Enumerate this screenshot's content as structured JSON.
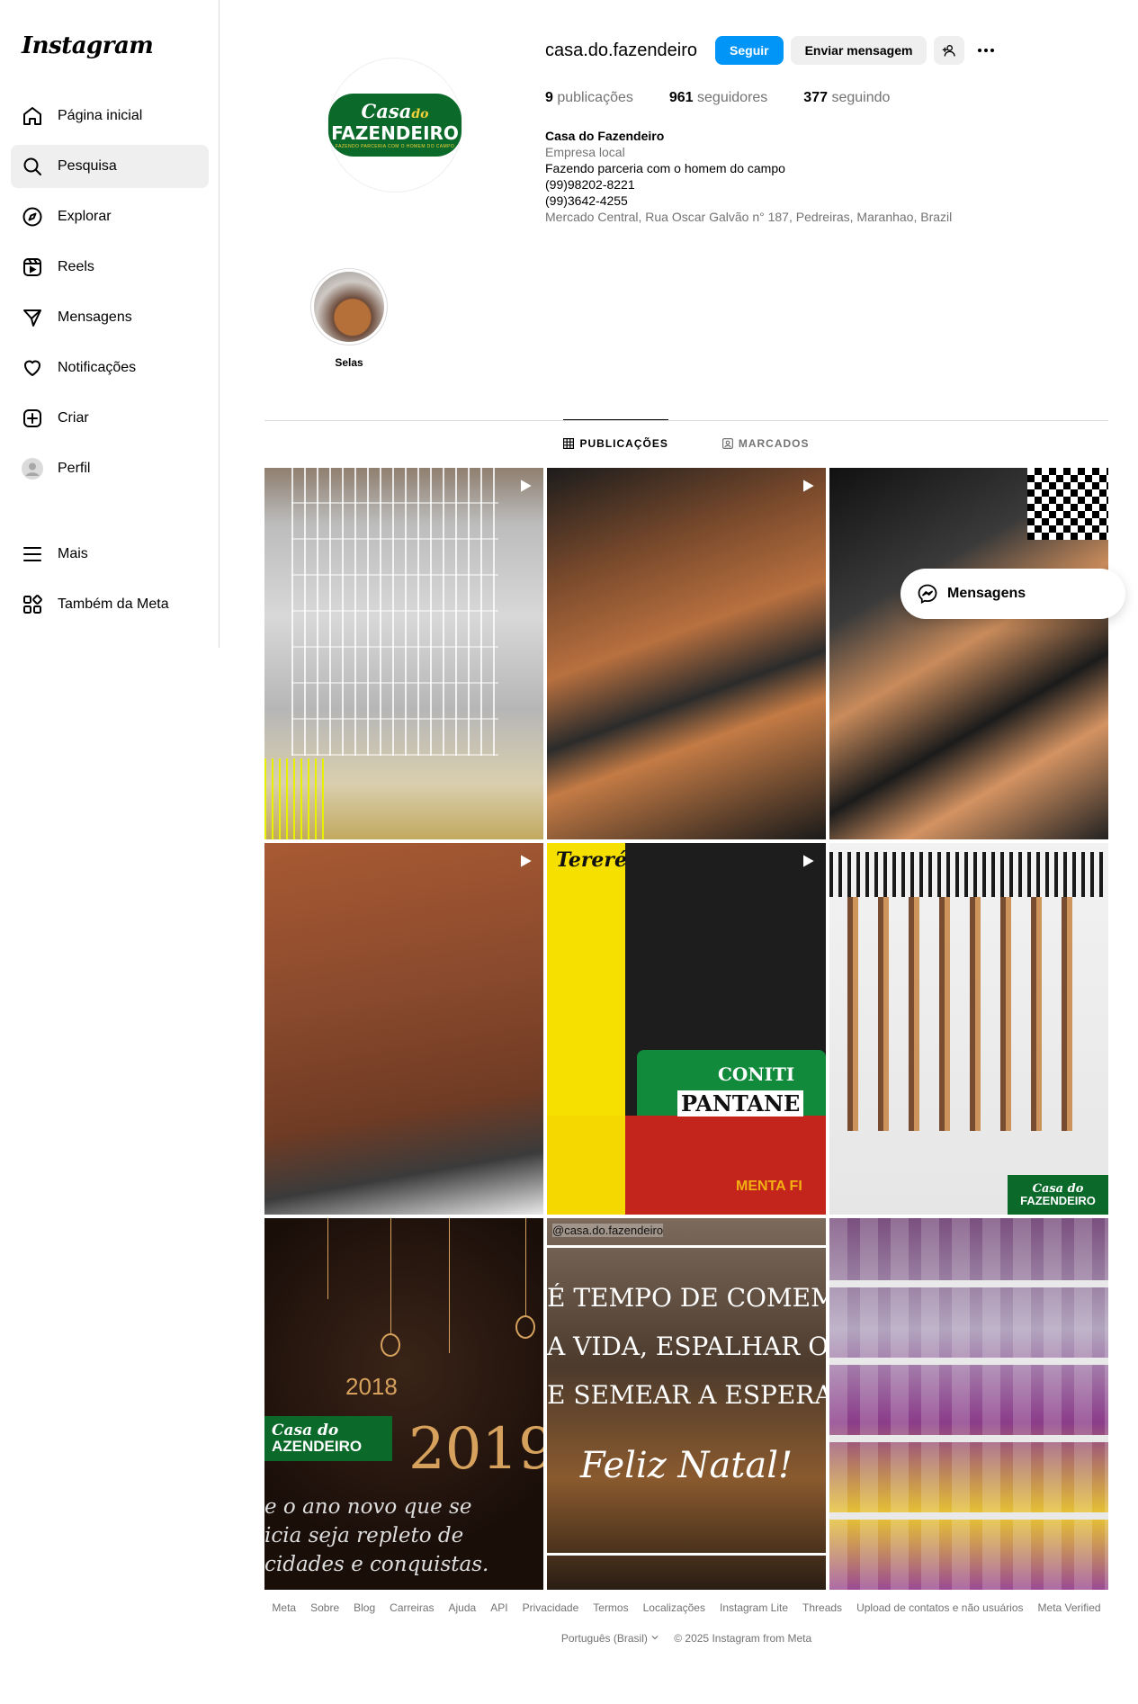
{
  "app": {
    "logo": "Instagram"
  },
  "sidebar": {
    "items": [
      {
        "label": "Página inicial",
        "icon": "home-icon"
      },
      {
        "label": "Pesquisa",
        "icon": "search-icon"
      },
      {
        "label": "Explorar",
        "icon": "compass-icon"
      },
      {
        "label": "Reels",
        "icon": "reels-icon"
      },
      {
        "label": "Mensagens",
        "icon": "messages-icon"
      },
      {
        "label": "Notificações",
        "icon": "heart-icon"
      },
      {
        "label": "Criar",
        "icon": "plus-square-icon"
      },
      {
        "label": "Perfil",
        "icon": "avatar-icon"
      }
    ],
    "bottom": [
      {
        "label": "Mais",
        "icon": "menu-icon"
      },
      {
        "label": "Também da Meta",
        "icon": "meta-apps-icon"
      }
    ]
  },
  "profile": {
    "username": "casa.do.fazendeiro",
    "follow_label": "Seguir",
    "message_label": "Enviar mensagem",
    "logo_text": {
      "line1": "Casa",
      "line1b": "do",
      "line2": "FAZENDEIRO",
      "line3": "FAZENDO PARCERIA COM O HOMEM DO CAMPO"
    },
    "stats": {
      "posts_count": "9",
      "posts_label": "publicações",
      "followers_count": "961",
      "followers_label": "seguidores",
      "following_count": "377",
      "following_label": "seguindo"
    },
    "bio": {
      "name": "Casa do Fazendeiro",
      "category": "Empresa local",
      "line1": "Fazendo parceria com o homem do campo",
      "phone1": "(99)98202-8221",
      "phone2": "(99)3642-4255",
      "address": "Mercado Central, Rua Oscar Galvão n° 187, Pedreiras, Maranhao, Brazil"
    },
    "highlights": [
      {
        "label": "Selas"
      }
    ]
  },
  "tabs": {
    "posts": "PUBLICAÇÕES",
    "tagged": "MARCADOS"
  },
  "posts": {
    "p5_text": {
      "a": "Tereré",
      "b": "CONITI",
      "c": "PANTANE",
      "d": "MENTA FI"
    },
    "p6_text": {
      "a": "Casa do",
      "b": "FAZENDEIRO"
    },
    "p7_text": {
      "year_a": "2018",
      "year_b": "2019",
      "brand_a": "Casa do",
      "brand_b": "AZENDEIRO",
      "message": "e o ano novo que se\nicia seja repleto de\ncidades e conquistas."
    },
    "p8_text": {
      "handle": "@casa.do.fazendeiro",
      "quote": "É TEMPO DE COMEMORAR\nA VIDA, ESPALHAR O AMOR\nE SEMEAR A ESPERANÇA.",
      "natal": "Feliz Natal!"
    }
  },
  "floating": {
    "label": "Mensagens"
  },
  "footer": {
    "links": [
      "Meta",
      "Sobre",
      "Blog",
      "Carreiras",
      "Ajuda",
      "API",
      "Privacidade",
      "Termos",
      "Localizações",
      "Instagram Lite",
      "Threads",
      "Upload de contatos e não usuários",
      "Meta Verified"
    ],
    "language": "Português (Brasil)",
    "copyright": "© 2025 Instagram from Meta"
  },
  "colors": {
    "primary": "#0095f6",
    "brand_green": "#0b6a2a",
    "muted": "#737373"
  }
}
